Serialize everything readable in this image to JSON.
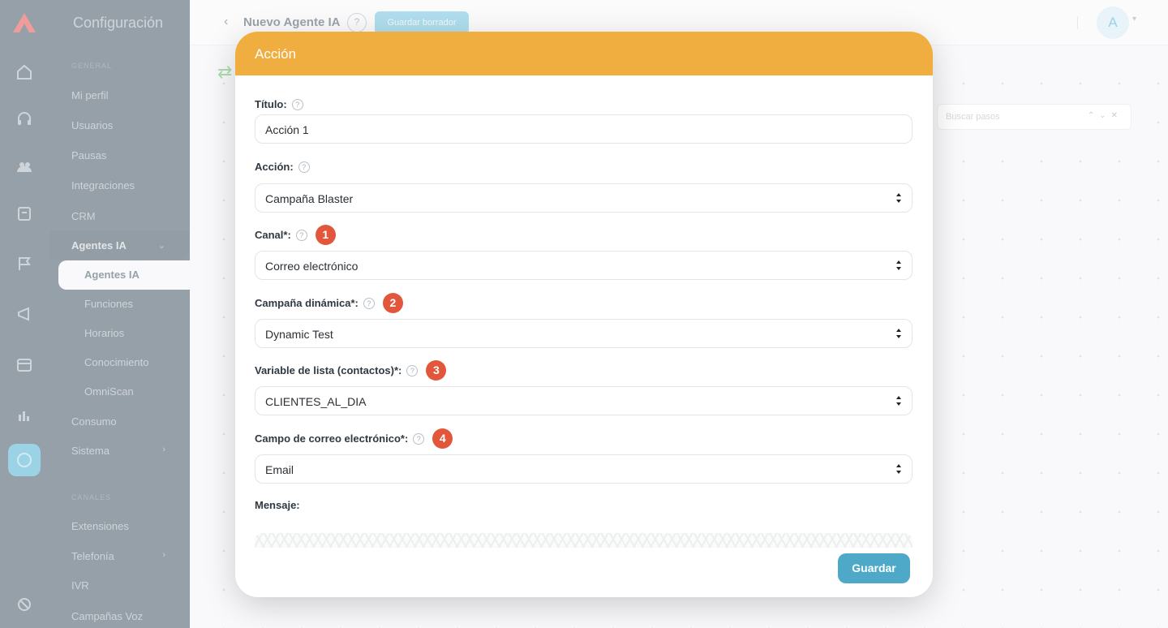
{
  "sidebar": {
    "title": "Configuración",
    "section_general": "GENERAL",
    "items": [
      {
        "label": "Mi perfil"
      },
      {
        "label": "Usuarios"
      },
      {
        "label": "Pausas"
      },
      {
        "label": "Integraciones"
      },
      {
        "label": "CRM"
      },
      {
        "label": "Agentes IA"
      },
      {
        "label": "Agentes IA"
      },
      {
        "label": "Funciones"
      },
      {
        "label": "Horarios"
      },
      {
        "label": "Conocimiento"
      },
      {
        "label": "OmniScan"
      },
      {
        "label": "Consumo"
      },
      {
        "label": "Sistema"
      },
      {
        "label": "Extensiones"
      },
      {
        "label": "Telefonía"
      },
      {
        "label": "IVR"
      },
      {
        "label": "Campañas Voz"
      }
    ],
    "section_canales": "CANALES"
  },
  "header": {
    "title": "Nuevo Agente IA",
    "help": "?",
    "button_label": "Guardar borrador",
    "avatar_initial": "A"
  },
  "canvas": {
    "search_placeholder": "Buscar pasos"
  },
  "modal": {
    "title": "Acción",
    "fields": {
      "titulo": {
        "label": "Título:",
        "value": "Acción 1"
      },
      "accion": {
        "label": "Acción:",
        "value": "Campaña Blaster"
      },
      "canal": {
        "label": "Canal*:",
        "value": "Correo electrónico",
        "badge": "1"
      },
      "campana": {
        "label": "Campaña dinámica*:",
        "value": "Dynamic Test",
        "badge": "2"
      },
      "variable": {
        "label": "Variable de lista (contactos)*:",
        "value": "CLIENTES_AL_DIA",
        "badge": "3"
      },
      "correo": {
        "label": "Campo de correo electrónico*:",
        "value": "Email",
        "badge": "4"
      },
      "mensaje": {
        "label": "Mensaje:"
      }
    },
    "save_label": "Guardar"
  },
  "colors": {
    "header_accent": "#f0ae40",
    "badge": "#e2573b",
    "primary_button": "#4ea9c8",
    "sidebar_bg": "#3e5363"
  },
  "icons": [
    "logo-icon",
    "home-icon",
    "headset-icon",
    "contacts-icon",
    "calendar-icon",
    "flag-icon",
    "campaign-icon",
    "schedule-icon",
    "chart-icon",
    "settings-icon",
    "extensions-icon",
    "help-icon",
    "chevron-down-icon",
    "chevron-right-icon",
    "back-icon",
    "select-arrows-icon"
  ]
}
